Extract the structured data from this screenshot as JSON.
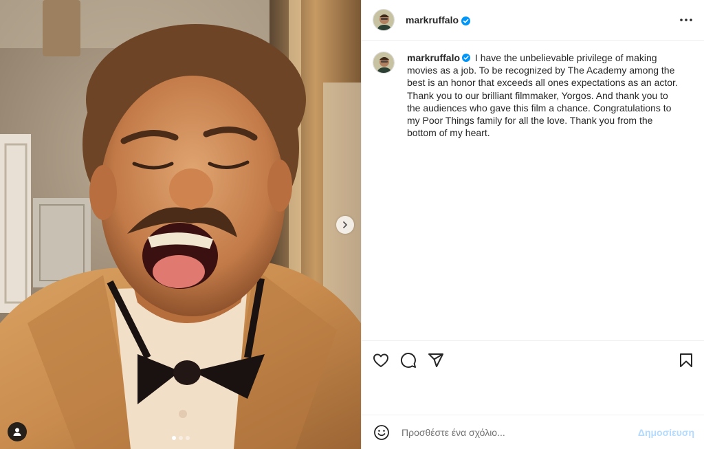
{
  "post": {
    "username": "markruffalo",
    "caption": "I have the unbelievable privilege of making movies as a job. To be recognized by The Academy among the best is an honor that exceeds all ones expectations as an actor. Thank you to our brilliant filmmaker, Yorgos. And thank you to the audiences who gave this film a chance. Congratulations to my Poor Things family for all the love. Thank you from the bottom of my heart.",
    "carousel": {
      "slide_count": 3,
      "active_index": 0
    }
  },
  "comment_box": {
    "placeholder": "Προσθέστε ένα σχόλιο...",
    "post_label": "Δημοσίευση"
  },
  "icons": {
    "verified": "verified-badge-icon",
    "more": "more-options-icon",
    "like": "heart-icon",
    "comment": "comment-icon",
    "share": "share-icon",
    "save": "bookmark-icon",
    "emoji": "emoji-icon",
    "next": "chevron-right-icon",
    "tags": "user-tag-icon"
  },
  "colors": {
    "verified": "#0095f6",
    "post_button_disabled": "#b3dbff",
    "divider": "#efefef"
  }
}
